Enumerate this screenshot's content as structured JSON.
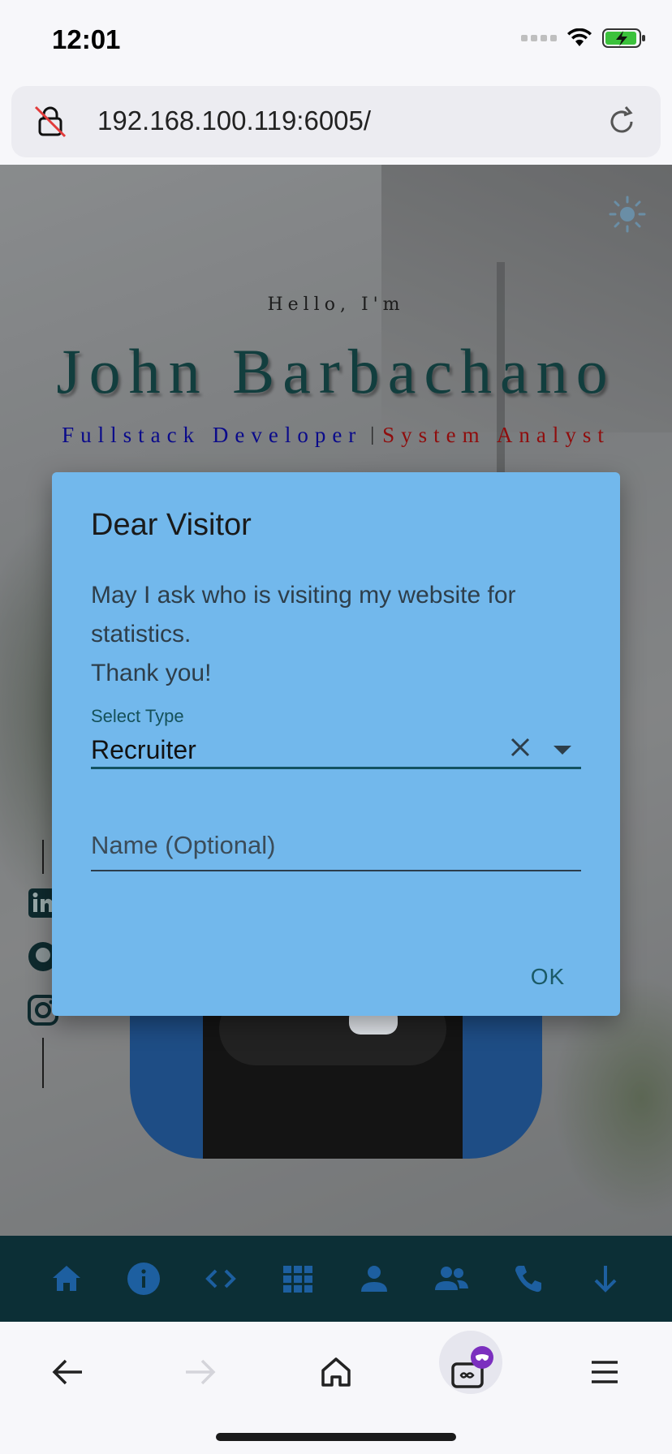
{
  "status_bar": {
    "time": "12:01"
  },
  "browser": {
    "url": "192.168.100.119:6005/",
    "toolbar": [
      "back",
      "forward",
      "home",
      "tabs",
      "menu"
    ]
  },
  "hero": {
    "greeting": "Hello, I'm",
    "name": "John Barbachano",
    "role_primary": "Fullstack Developer",
    "role_separator": "|",
    "role_secondary": "System Analyst",
    "colors": {
      "name": "#123e3e",
      "role_primary": "#0a0a8a",
      "role_secondary": "#8f0d0d"
    }
  },
  "social": [
    "linkedin-icon",
    "github-icon",
    "instagram-icon"
  ],
  "bottom_nav": [
    "home-icon",
    "info-icon",
    "code-icon",
    "grid-icon",
    "person-icon",
    "people-icon",
    "phone-icon",
    "arrow-down-icon"
  ],
  "modal": {
    "title": "Dear Visitor",
    "message_line1": "May I ask who is visiting my website for statistics.",
    "message_line2": "Thank you!",
    "select_label": "Select Type",
    "select_value": "Recruiter",
    "name_placeholder": "Name (Optional)",
    "ok_label": "OK",
    "colors": {
      "background": "#72b8ec",
      "accent": "#125262"
    }
  }
}
